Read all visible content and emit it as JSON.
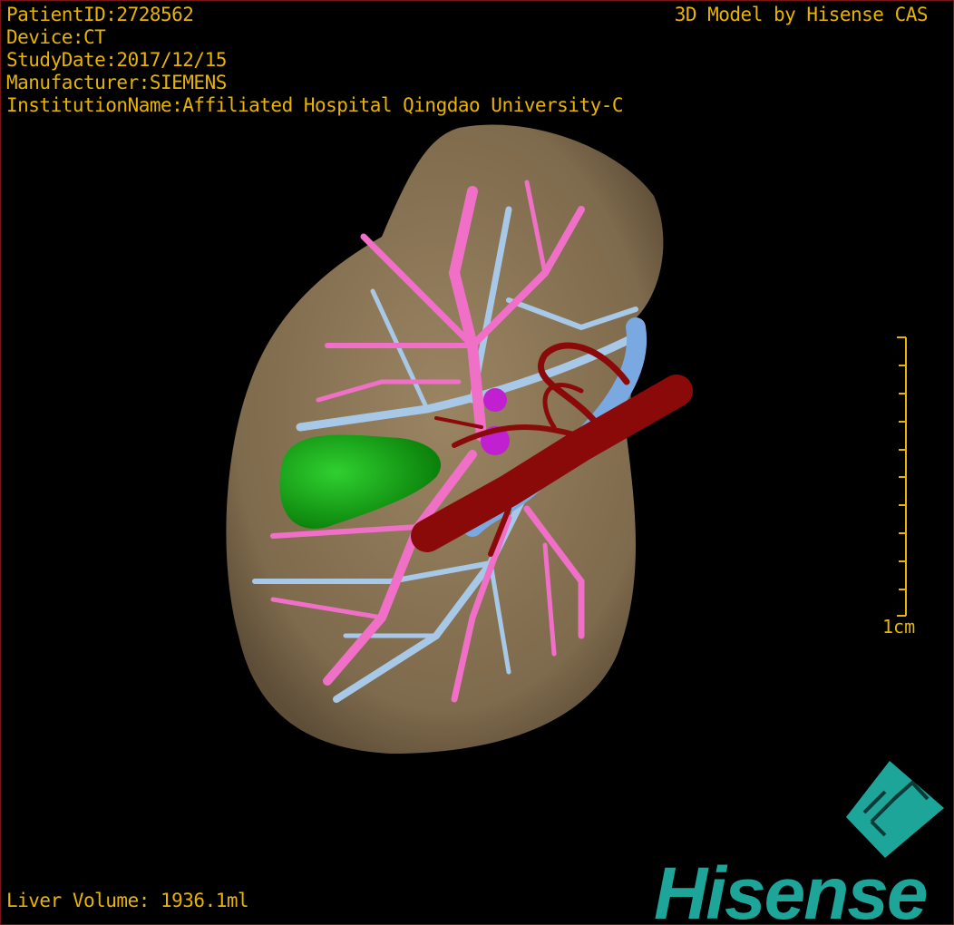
{
  "overlay": {
    "patient_id": "PatientID:2728562",
    "device": "Device:CT",
    "study_date": "StudyDate:2017/12/15",
    "manufacturer": "Manufacturer:SIEMENS",
    "institution": "InstitutionName:Affiliated Hospital Qingdao University-C",
    "credit": "3D Model by Hisense CAS",
    "liver_volume": "Liver Volume: 1936.1ml",
    "scale_label": "1cm"
  },
  "logo": {
    "brand": "Hisense",
    "cube_letters": [
      "F",
      "L"
    ],
    "color": "#1ea59a"
  },
  "colors": {
    "text": "#e8b400",
    "liver": "#8a7455",
    "portal_vein": "#f070c8",
    "hepatic_vein": "#a8c8e8",
    "artery": "#8a0a0a",
    "gallbladder": "#1aa51a",
    "tumor": "#c020d0",
    "border": "#7a1515"
  }
}
